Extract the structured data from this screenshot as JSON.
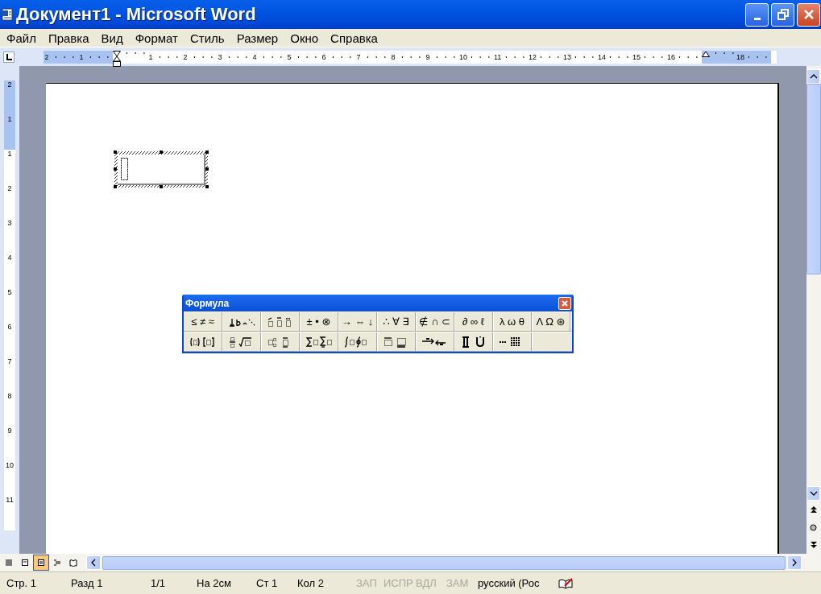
{
  "window": {
    "title": "Документ1 - Microsoft Word"
  },
  "menu": [
    {
      "label": "Файл"
    },
    {
      "label": "Правка"
    },
    {
      "label": "Вид"
    },
    {
      "label": "Формат"
    },
    {
      "label": "Стиль"
    },
    {
      "label": "Размер"
    },
    {
      "label": "Окно"
    },
    {
      "label": "Справка"
    }
  ],
  "ruler": {
    "marks": [
      {
        "kind": "margin",
        "text": "2"
      },
      {
        "kind": "margin",
        "text": "1"
      },
      {
        "kind": "left-indent"
      },
      {
        "kind": "number",
        "text": "1"
      },
      {
        "kind": "number",
        "text": "2"
      },
      {
        "kind": "number",
        "text": "3"
      },
      {
        "kind": "number",
        "text": "4"
      },
      {
        "kind": "number",
        "text": "5"
      },
      {
        "kind": "number",
        "text": "6"
      },
      {
        "kind": "number",
        "text": "7"
      },
      {
        "kind": "number",
        "text": "8"
      },
      {
        "kind": "number",
        "text": "9"
      },
      {
        "kind": "number",
        "text": "10"
      },
      {
        "kind": "number",
        "text": "11"
      },
      {
        "kind": "number",
        "text": "12"
      },
      {
        "kind": "number",
        "text": "13"
      },
      {
        "kind": "number",
        "text": "14"
      },
      {
        "kind": "number",
        "text": "15"
      },
      {
        "kind": "number",
        "text": "16"
      },
      {
        "kind": "right-indent"
      },
      {
        "kind": "margin",
        "text": "18"
      }
    ]
  },
  "vertical_ruler": {
    "marks": [
      {
        "kind": "margin",
        "text": "2"
      },
      {
        "kind": "margin",
        "text": "1"
      },
      {
        "kind": "number",
        "text": "1"
      },
      {
        "kind": "number",
        "text": "2"
      },
      {
        "kind": "number",
        "text": "3"
      },
      {
        "kind": "number",
        "text": "4"
      },
      {
        "kind": "number",
        "text": "5"
      },
      {
        "kind": "number",
        "text": "6"
      },
      {
        "kind": "number",
        "text": "7"
      },
      {
        "kind": "number",
        "text": "8"
      },
      {
        "kind": "number",
        "text": "9"
      },
      {
        "kind": "number",
        "text": "10"
      },
      {
        "kind": "number",
        "text": "11"
      }
    ]
  },
  "formula_toolbar": {
    "title": "Формула",
    "rows": [
      [
        {
          "kind": "symbols",
          "label": "≤ ≠ ≈"
        },
        {
          "kind": "spaces"
        },
        {
          "kind": "embellishments"
        },
        {
          "kind": "symbols",
          "label": "± • ⊗"
        },
        {
          "kind": "symbols",
          "label": "→ ⇔ ↓"
        },
        {
          "kind": "symbols",
          "label": "∴ ∀ ∃"
        },
        {
          "kind": "symbols",
          "label": "∉ ∩ ⊂"
        },
        {
          "kind": "symbols",
          "label": "∂ ∞ ℓ"
        },
        {
          "kind": "symbols",
          "label": "λ ω θ"
        },
        {
          "kind": "symbols",
          "label": "Λ Ω ⊛"
        }
      ],
      [
        {
          "kind": "fences"
        },
        {
          "kind": "fraction"
        },
        {
          "kind": "scripts"
        },
        {
          "kind": "sum"
        },
        {
          "kind": "integral"
        },
        {
          "kind": "bars"
        },
        {
          "kind": "arrows"
        },
        {
          "kind": "products"
        },
        {
          "kind": "matrix"
        }
      ]
    ]
  },
  "view_buttons": [
    {
      "selected": false
    },
    {
      "selected": false
    },
    {
      "selected": true
    },
    {
      "selected": false
    },
    {
      "selected": false
    }
  ],
  "status_bar": [
    {
      "text": "Стр. 1",
      "disabled": false
    },
    {
      "text": "Разд 1",
      "disabled": false
    },
    {
      "text": "1/1",
      "disabled": false
    },
    {
      "text": "На 2см",
      "disabled": false
    },
    {
      "text": "Ст 1",
      "disabled": false
    },
    {
      "text": "Кол 2",
      "disabled": false
    },
    {
      "text": "ЗАП",
      "disabled": true
    },
    {
      "text": "ИСПР",
      "disabled": true
    },
    {
      "text": "ВДЛ",
      "disabled": true
    },
    {
      "text": "ЗАМ",
      "disabled": true
    },
    {
      "text": "русский (Рос",
      "disabled": false
    }
  ]
}
